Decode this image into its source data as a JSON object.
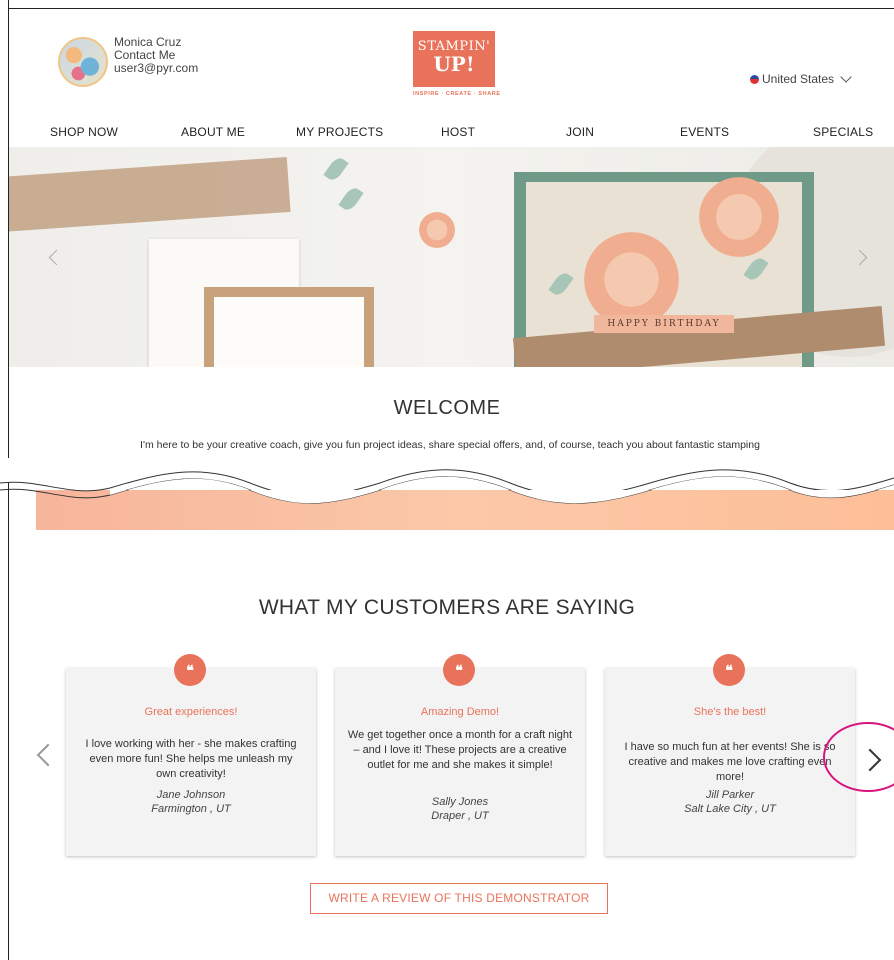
{
  "profile": {
    "name": "Monica Cruz",
    "contact_label": "Contact Me",
    "email": "user3@pyr.com"
  },
  "logo": {
    "line1": "STAMPIN'",
    "line2": "UP!",
    "tagline": "INSPIRE · CREATE · SHARE",
    "brand_color": "#e8735a"
  },
  "country": {
    "label": "United States",
    "flag_icon": "us-flag-icon"
  },
  "nav": {
    "items": [
      "SHOP NOW",
      "ABOUT ME",
      "MY PROJECTS",
      "HOST",
      "JOIN",
      "EVENTS",
      "SPECIALS"
    ]
  },
  "hero": {
    "banner_text": "HAPPY BIRTHDAY"
  },
  "welcome": {
    "title": "WELCOME",
    "text": "I'm here to be your creative coach, give you fun project ideas, share special offers, and, of course, teach you about fantastic stamping products. Send me an e-mail or give me a call; I look forward to helping you unleash your creativity!"
  },
  "testimonials": {
    "title": "WHAT MY CUSTOMERS ARE SAYING",
    "items": [
      {
        "heading": "Great experiences!",
        "body": "I love working with her - she makes crafting even more fun! She helps me unleash my own creativity!",
        "name": "Jane Johnson",
        "location": "Farmington , UT"
      },
      {
        "heading": "Amazing Demo!",
        "body": "We get together once a month for a craft night – and I love it! These projects are a creative outlet for me and she makes it simple!",
        "name": "Sally Jones",
        "location": "Draper , UT"
      },
      {
        "heading": "She's the best!",
        "body": "I have so much fun at her events! She is so creative and makes me love crafting even more!",
        "name": "Jill Parker",
        "location": "Salt Lake City , UT"
      }
    ]
  },
  "review_button": {
    "label": "WRITE A REVIEW OF THIS DEMONSTRATOR"
  },
  "colors": {
    "accent": "#e8735a",
    "highlight": "#d8157f"
  }
}
